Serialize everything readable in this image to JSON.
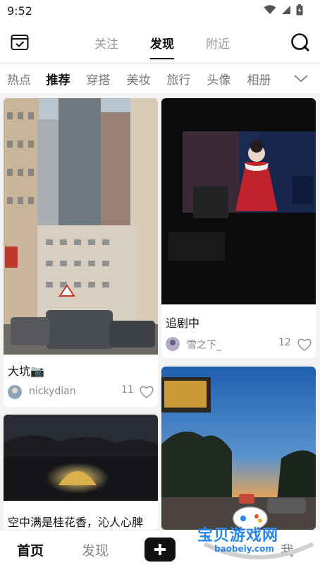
{
  "status_bar": {
    "time": "9:52"
  },
  "top_tabs": [
    {
      "label": "关注"
    },
    {
      "label": "发现"
    },
    {
      "label": "附近"
    }
  ],
  "categories": [
    {
      "label": "热点"
    },
    {
      "label": "推荐"
    },
    {
      "label": "穿搭"
    },
    {
      "label": "美妆"
    },
    {
      "label": "旅行"
    },
    {
      "label": "头像"
    },
    {
      "label": "相册"
    }
  ],
  "feed": [
    {
      "title": "大坑📷",
      "user": "nickydian",
      "likes": "11"
    },
    {
      "title": "追剧中",
      "user": "雪之下_",
      "likes": "12"
    },
    {
      "title": "空中满是桂花香，沁人心脾"
    }
  ],
  "bottom_nav": {
    "home": "首页",
    "discover": "发现",
    "me": "我"
  },
  "watermark": {
    "text": "宝贝游戏网",
    "url": "baobeiy.com"
  },
  "colors": {
    "accent": "#111111",
    "watermark_blue": "#2a86e8"
  }
}
